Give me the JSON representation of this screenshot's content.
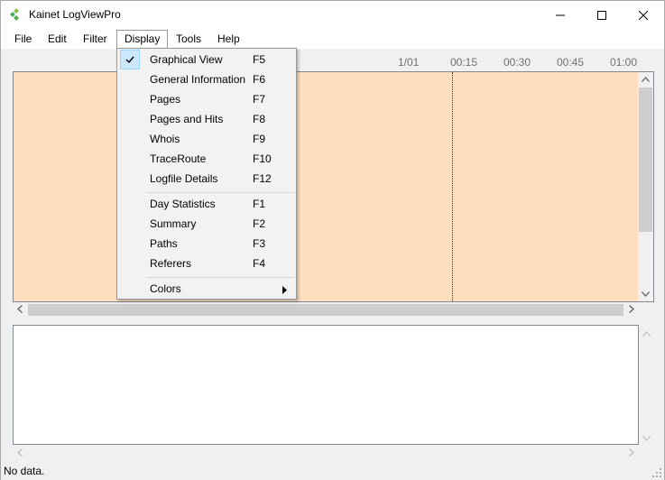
{
  "window": {
    "title": "Kainet LogViewPro"
  },
  "menubar": {
    "items": [
      {
        "label": "File"
      },
      {
        "label": "Edit"
      },
      {
        "label": "Filter"
      },
      {
        "label": "Display"
      },
      {
        "label": "Tools"
      },
      {
        "label": "Help"
      }
    ],
    "active": "Display"
  },
  "timeline": {
    "labels": [
      "1/01",
      "00:15",
      "00:30",
      "00:45",
      "01:00"
    ]
  },
  "display_menu": {
    "groups": [
      [
        {
          "label": "Graphical View",
          "shortcut": "F5",
          "checked": true
        },
        {
          "label": "General Information",
          "shortcut": "F6"
        },
        {
          "label": "Pages",
          "shortcut": "F7"
        },
        {
          "label": "Pages and Hits",
          "shortcut": "F8"
        },
        {
          "label": "Whois",
          "shortcut": "F9"
        },
        {
          "label": "TraceRoute",
          "shortcut": "F10"
        },
        {
          "label": "Logfile Details",
          "shortcut": "F12"
        }
      ],
      [
        {
          "label": "Day Statistics",
          "shortcut": "F1"
        },
        {
          "label": "Summary",
          "shortcut": "F2"
        },
        {
          "label": "Paths",
          "shortcut": "F3"
        },
        {
          "label": "Referers",
          "shortcut": "F4"
        }
      ],
      [
        {
          "label": "Colors",
          "shortcut": "",
          "submenu": true
        }
      ]
    ]
  },
  "statusbar": {
    "text": "No data."
  },
  "colors": {
    "graph_background": "#ffdfbf",
    "app_icon": "#4caf50",
    "menu_highlight": "#cce8ff"
  }
}
